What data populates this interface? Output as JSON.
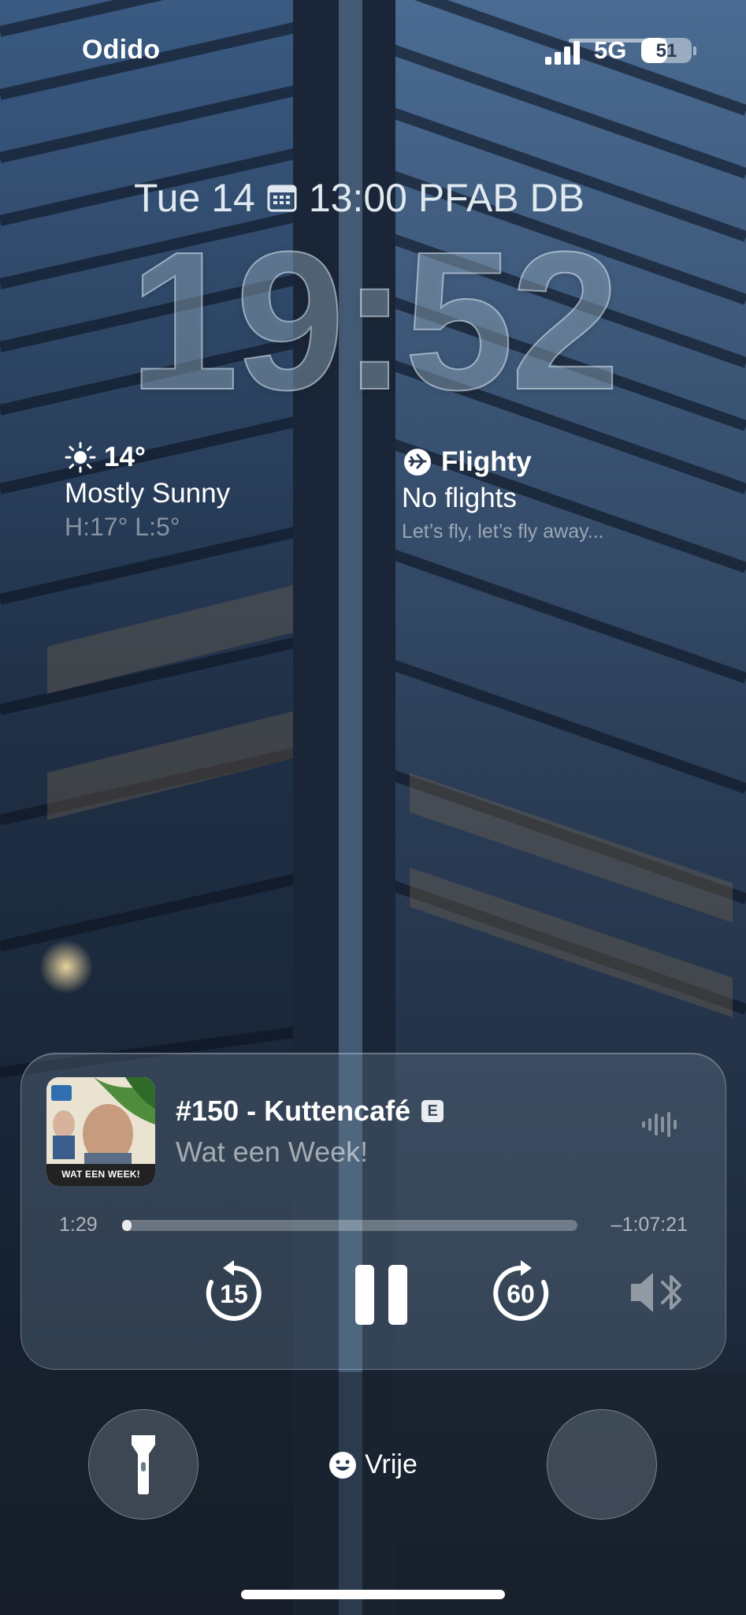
{
  "status_bar": {
    "carrier": "Odido",
    "network": "5G",
    "battery_percent": "51",
    "battery_level": 0.51,
    "signal_bars": 4
  },
  "lock_screen": {
    "date": "Tue 14",
    "calendar_event": "13:00 PFAB DB",
    "time": "19:52"
  },
  "widgets": {
    "weather": {
      "temperature": "14°",
      "condition": "Mostly Sunny",
      "high_low": "H:17° L:5°",
      "icon": "sun-icon"
    },
    "flighty": {
      "app_name": "Flighty",
      "status": "No flights",
      "tagline": "Let’s fly, let’s fly away...",
      "icon": "plane-icon"
    }
  },
  "now_playing": {
    "title": "#150 - Kuttencafé",
    "explicit_label": "E",
    "artist": "Wat een Week!",
    "artwork_caption": "WAT EEN WEEK!",
    "elapsed": "1:29",
    "remaining": "–1:07:21",
    "progress": 0.02,
    "skip_back_seconds": "15",
    "skip_forward_seconds": "60",
    "output_icon": "speaker-bluetooth-icon"
  },
  "bottom": {
    "focus_label": "Vrije",
    "focus_icon": "smile-icon",
    "left_button_icon": "flashlight-icon"
  }
}
